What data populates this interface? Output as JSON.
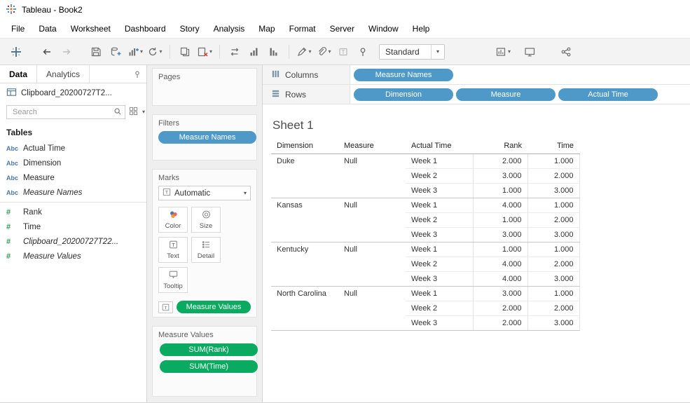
{
  "colors": {
    "pill_blue": "#4E99C8",
    "pill_green": "#0AAA60"
  },
  "icons": {
    "caret_down": "▾"
  },
  "window": {
    "title": "Tableau - Book2"
  },
  "menubar": {
    "items": [
      "File",
      "Data",
      "Worksheet",
      "Dashboard",
      "Story",
      "Analysis",
      "Map",
      "Format",
      "Server",
      "Window",
      "Help"
    ]
  },
  "toolbar": {
    "fit_selector": {
      "value": "Standard"
    },
    "icons": [
      "tableau-logo",
      "undo",
      "redo",
      "save",
      "add-data-source",
      "new-worksheet",
      "refresh-data",
      "duplicate-sheet",
      "clear-sheet",
      "swap-rows-columns",
      "sort-ascending",
      "sort-descending",
      "highlight",
      "group-members",
      "show-mark-labels",
      "fix-axes",
      "fit-selector",
      "show-hide-cards",
      "presentation-mode",
      "share-workbook"
    ]
  },
  "sidebar": {
    "tabs": {
      "data": "Data",
      "analytics": "Analytics"
    },
    "datasource": "Clipboard_20200727T2...",
    "search": {
      "placeholder": "Search"
    },
    "tables_header": "Tables",
    "fields": [
      {
        "type": "dimension",
        "icon": "Abc",
        "label": "Actual Time",
        "italic": false
      },
      {
        "type": "dimension",
        "icon": "Abc",
        "label": "Dimension",
        "italic": false
      },
      {
        "type": "dimension",
        "icon": "Abc",
        "label": "Measure",
        "italic": false
      },
      {
        "type": "dimension",
        "icon": "Abc",
        "label": "Measure Names",
        "italic": true
      },
      {
        "type": "measure",
        "icon": "#",
        "label": "Rank",
        "italic": false
      },
      {
        "type": "measure",
        "icon": "#",
        "label": "Time",
        "italic": false
      },
      {
        "type": "measure",
        "icon": "#",
        "label": "Clipboard_20200727T22...",
        "italic": true
      },
      {
        "type": "measure",
        "icon": "#",
        "label": "Measure Values",
        "italic": true
      }
    ]
  },
  "cards": {
    "pages": {
      "title": "Pages"
    },
    "filters": {
      "title": "Filters",
      "pills": [
        {
          "label": "Measure Names",
          "color": "blue"
        }
      ]
    },
    "marks": {
      "title": "Marks",
      "mark_type": "Automatic",
      "buttons": [
        {
          "label": "Color"
        },
        {
          "label": "Size"
        },
        {
          "label": "Text"
        },
        {
          "label": "Detail"
        },
        {
          "label": "Tooltip"
        }
      ],
      "pill": {
        "label": "Measure Values",
        "color": "green"
      }
    },
    "measure_values": {
      "title": "Measure Values",
      "pills": [
        {
          "label": "SUM(Rank)",
          "color": "green"
        },
        {
          "label": "SUM(Time)",
          "color": "green"
        }
      ]
    }
  },
  "shelves": {
    "columns": {
      "label": "Columns",
      "pills": [
        {
          "label": "Measure Names",
          "color": "blue"
        }
      ]
    },
    "rows": {
      "label": "Rows",
      "pills": [
        {
          "label": "Dimension",
          "color": "blue"
        },
        {
          "label": "Measure",
          "color": "blue"
        },
        {
          "label": "Actual Time",
          "color": "blue"
        }
      ]
    }
  },
  "sheet": {
    "title": "Sheet 1",
    "table": {
      "headers": [
        "Dimension",
        "Measure",
        "Actual Time",
        "Rank",
        "Time"
      ],
      "groups": [
        {
          "dimension": "Duke",
          "measure": "Null",
          "rows": [
            {
              "week": "Week 1",
              "rank": "2.000",
              "time": "1.000"
            },
            {
              "week": "Week 2",
              "rank": "3.000",
              "time": "2.000"
            },
            {
              "week": "Week 3",
              "rank": "1.000",
              "time": "3.000"
            }
          ]
        },
        {
          "dimension": "Kansas",
          "measure": "Null",
          "rows": [
            {
              "week": "Week 1",
              "rank": "4.000",
              "time": "1.000"
            },
            {
              "week": "Week 2",
              "rank": "1.000",
              "time": "2.000"
            },
            {
              "week": "Week 3",
              "rank": "3.000",
              "time": "3.000"
            }
          ]
        },
        {
          "dimension": "Kentucky",
          "measure": "Null",
          "rows": [
            {
              "week": "Week 1",
              "rank": "1.000",
              "time": "1.000"
            },
            {
              "week": "Week 2",
              "rank": "4.000",
              "time": "2.000"
            },
            {
              "week": "Week 3",
              "rank": "4.000",
              "time": "3.000"
            }
          ]
        },
        {
          "dimension": "North Carolina",
          "measure": "Null",
          "rows": [
            {
              "week": "Week 1",
              "rank": "3.000",
              "time": "1.000"
            },
            {
              "week": "Week 2",
              "rank": "2.000",
              "time": "2.000"
            },
            {
              "week": "Week 3",
              "rank": "2.000",
              "time": "3.000"
            }
          ]
        }
      ]
    }
  }
}
